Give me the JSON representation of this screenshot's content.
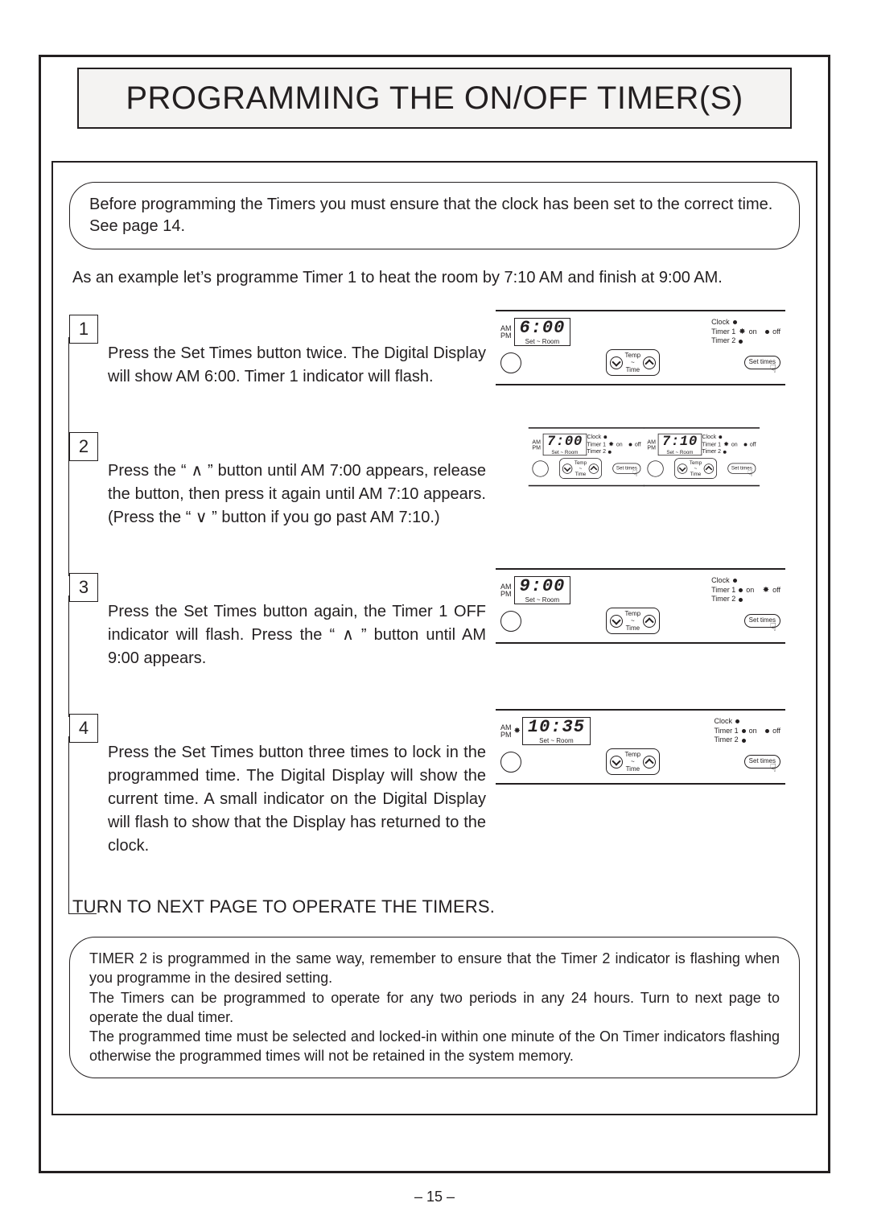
{
  "title": "PROGRAMMING THE ON/OFF TIMER(S)",
  "pre_note": "Before programming the Timers you must ensure that the clock has been set to the correct time.  See page 14.",
  "intro": "As an example let’s programme Timer 1 to heat the room by 7:10 AM and finish at 9:00 AM.",
  "steps": [
    {
      "n": "1",
      "text": "Press the Set Times button twice.  The Digital Display will show AM 6:00.  Timer 1 indicator will flash.",
      "panels": [
        {
          "time": "6:00",
          "ampm": "AM\nPM",
          "set_room": "Set  ~  Room",
          "clock": "Clock",
          "t1": "Timer 1",
          "t2": "Timer 2",
          "on": "on",
          "off": "off",
          "t1_on_flash": true,
          "temp": "Temp",
          "tempsub": "~",
          "time_lbl": "Time",
          "settimes": "Set times"
        }
      ]
    },
    {
      "n": "2",
      "text": "Press the “ ∧ ” button until AM 7:00 appears, release the button, then press it again until AM 7:10 appears.  (Press the “ ∨ ” button if you go past AM 7:10.)",
      "panels": [
        {
          "time": "7:00",
          "ampm": "AM\nPM",
          "set_room": "Set  ~  Room",
          "clock": "Clock",
          "t1": "Timer 1",
          "t2": "Timer 2",
          "on": "on",
          "off": "off",
          "t1_on_flash": true,
          "temp": "Temp",
          "tempsub": "~",
          "time_lbl": "Time",
          "settimes": "Set times"
        },
        {
          "time": "7:10",
          "ampm": "AM\nPM",
          "set_room": "Set  ~  Room",
          "clock": "Clock",
          "t1": "Timer 1",
          "t2": "Timer 2",
          "on": "on",
          "off": "off",
          "t1_on_flash": true,
          "temp": "Temp",
          "tempsub": "~",
          "time_lbl": "Time",
          "settimes": "Set times"
        }
      ]
    },
    {
      "n": "3",
      "text": "Press the Set Times button again, the Timer 1 OFF indicator will flash.  Press the “ ∧ ” button until AM 9:00 appears.",
      "panels": [
        {
          "time": "9:00",
          "ampm": "AM\nPM",
          "set_room": "Set  ~  Room",
          "clock": "Clock",
          "t1": "Timer 1",
          "t2": "Timer 2",
          "on": "on",
          "off": "off",
          "t1_off_flash": true,
          "temp": "Temp",
          "tempsub": "~",
          "time_lbl": "Time",
          "settimes": "Set times"
        }
      ]
    },
    {
      "n": "4",
      "text": "Press the Set Times button three times to lock in the programmed time.  The Digital Display will show the current time.  A small indicator on the Digital Display will flash to show that the Display has returned to the clock.",
      "panels": [
        {
          "time": "10:35",
          "ampm": "AM\nPM",
          "set_room": "Set  ~  Room",
          "clock": "Clock",
          "t1": "Timer 1",
          "t2": "Timer 2",
          "on": "on",
          "off": "off",
          "temp": "Temp",
          "tempsub": "~",
          "time_lbl": "Time",
          "settimes": "Set times",
          "clock_flash": true
        }
      ]
    }
  ],
  "next_page": "TURN TO NEXT PAGE TO OPERATE THE TIMERS.",
  "post_note": "TIMER 2 is programmed in the same way, remember to ensure that the Timer 2 indicator is flashing when you programme in the desired setting.\nThe Timers can be programmed to operate for any two periods in any 24 hours.  Turn to next page to operate the dual timer.\nThe programmed time must be selected and locked-in within one minute of the On Timer indicators flashing otherwise the programmed times will not be retained in the system memory.",
  "page_number": "– 15 –"
}
